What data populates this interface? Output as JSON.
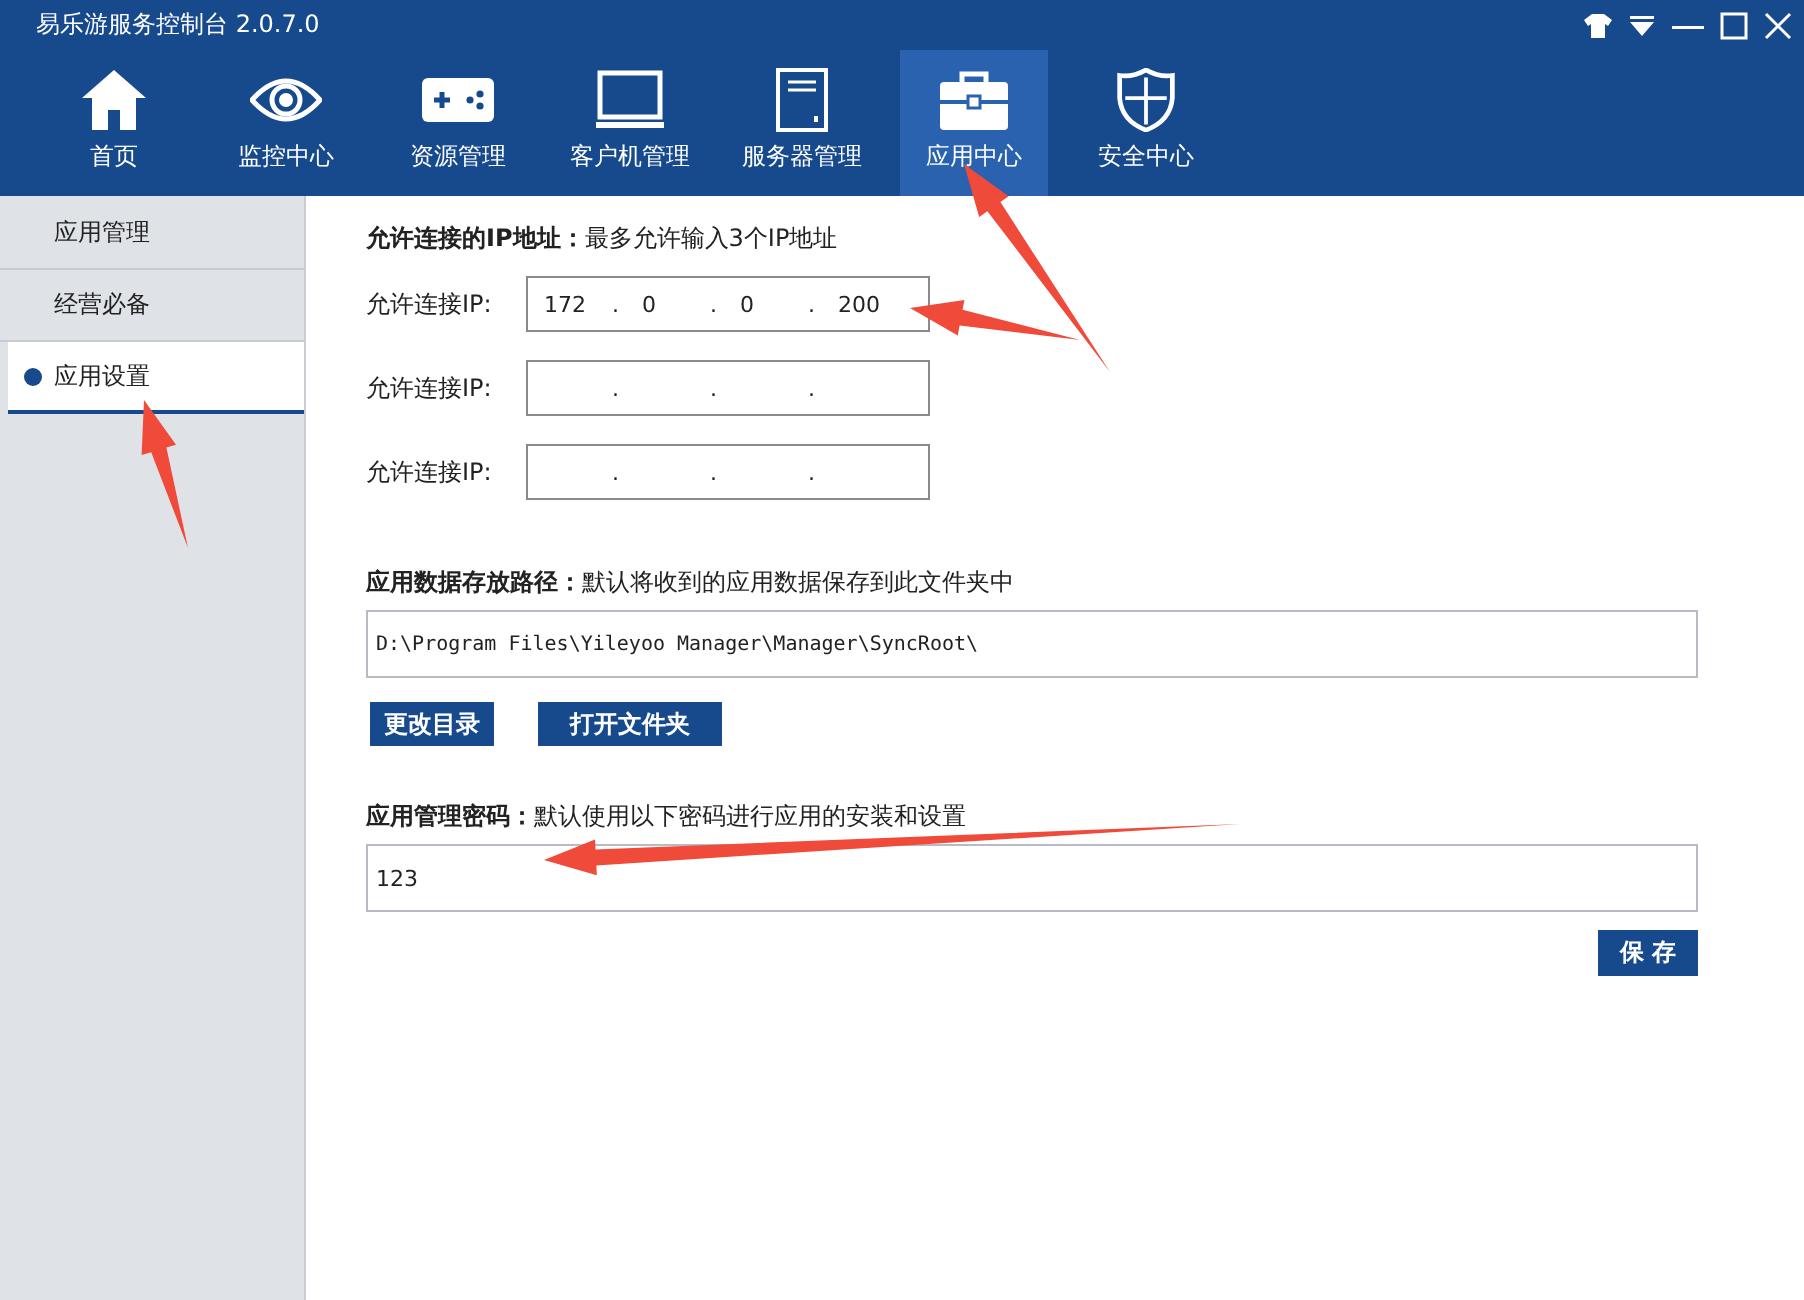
{
  "window": {
    "title": "易乐游服务控制台 2.0.7.0"
  },
  "nav": [
    {
      "label": "首页",
      "selected": false
    },
    {
      "label": "监控中心",
      "selected": false
    },
    {
      "label": "资源管理",
      "selected": false
    },
    {
      "label": "客户机管理",
      "selected": false
    },
    {
      "label": "服务器管理",
      "selected": false
    },
    {
      "label": "应用中心",
      "selected": true
    },
    {
      "label": "安全中心",
      "selected": false
    }
  ],
  "sidebar": {
    "items": [
      {
        "label": "应用管理",
        "selected": false
      },
      {
        "label": "经营必备",
        "selected": false
      },
      {
        "label": "应用设置",
        "selected": true
      }
    ]
  },
  "ip_section": {
    "heading": "允许连接的IP地址：",
    "hint": "最多允许输入3个IP地址",
    "fields": [
      {
        "label": "允许连接IP:",
        "separator": ".",
        "octets": [
          "172",
          "0",
          "0",
          "200"
        ]
      },
      {
        "label": "允许连接IP:",
        "separator": "."
      },
      {
        "label": "允许连接IP:",
        "separator": "."
      }
    ]
  },
  "path_section": {
    "heading": "应用数据存放路径：",
    "hint": "默认将收到的应用数据保存到此文件夹中",
    "value": "D:\\Program Files\\Yileyoo Manager\\Manager\\SyncRoot\\",
    "buttons": [
      "更改目录",
      "打开文件夹"
    ]
  },
  "password_section": {
    "heading": "应用管理密码：",
    "hint": "默认使用以下密码进行应用的安装和设置",
    "value": "123"
  },
  "save_button": "保 存"
}
